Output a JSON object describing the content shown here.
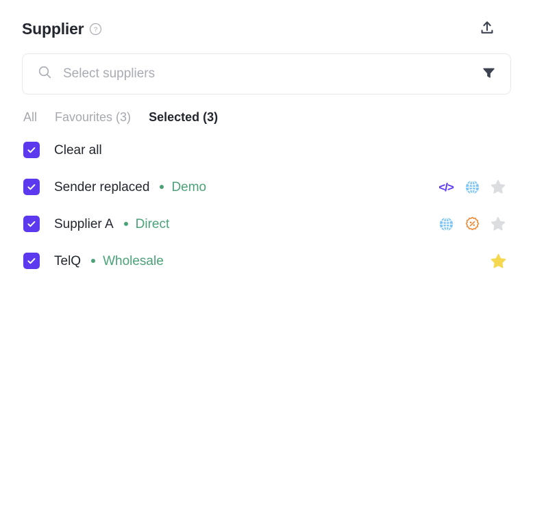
{
  "header": {
    "title": "Supplier",
    "help_icon": "question-circle-icon",
    "upload_icon": "upload-icon"
  },
  "search": {
    "placeholder": "Select suppliers",
    "value": "",
    "search_icon": "search-icon",
    "filter_icon": "filter-funnel-icon"
  },
  "tabs": [
    {
      "label": "All",
      "active": false
    },
    {
      "label": "Favourites (3)",
      "active": false
    },
    {
      "label": "Selected (3)",
      "active": true
    }
  ],
  "list": {
    "clear_all": {
      "label": "Clear all",
      "checked": true
    },
    "items": [
      {
        "name": "Sender replaced",
        "tag": "Demo",
        "checked": true,
        "icons": [
          {
            "name": "code-icon",
            "glyph": "</>"
          },
          {
            "name": "globe-icon"
          },
          {
            "name": "star-icon",
            "state": "off"
          }
        ]
      },
      {
        "name": "Supplier A",
        "tag": "Direct",
        "checked": true,
        "icons": [
          {
            "name": "globe-icon"
          },
          {
            "name": "discount-percent-icon"
          },
          {
            "name": "star-icon",
            "state": "off"
          }
        ]
      },
      {
        "name": "TelQ",
        "tag": "Wholesale",
        "checked": true,
        "icons": [
          {
            "name": "star-icon",
            "state": "on"
          }
        ]
      }
    ]
  },
  "colors": {
    "checkbox": "#5c38ef",
    "tag_green": "#4aa277",
    "code_purple": "#5c38ef",
    "globe_blue": "#7cc4f7",
    "discount_orange": "#ef8b36",
    "star_off": "#dcdde0",
    "star_on": "#f4d košt"
  }
}
